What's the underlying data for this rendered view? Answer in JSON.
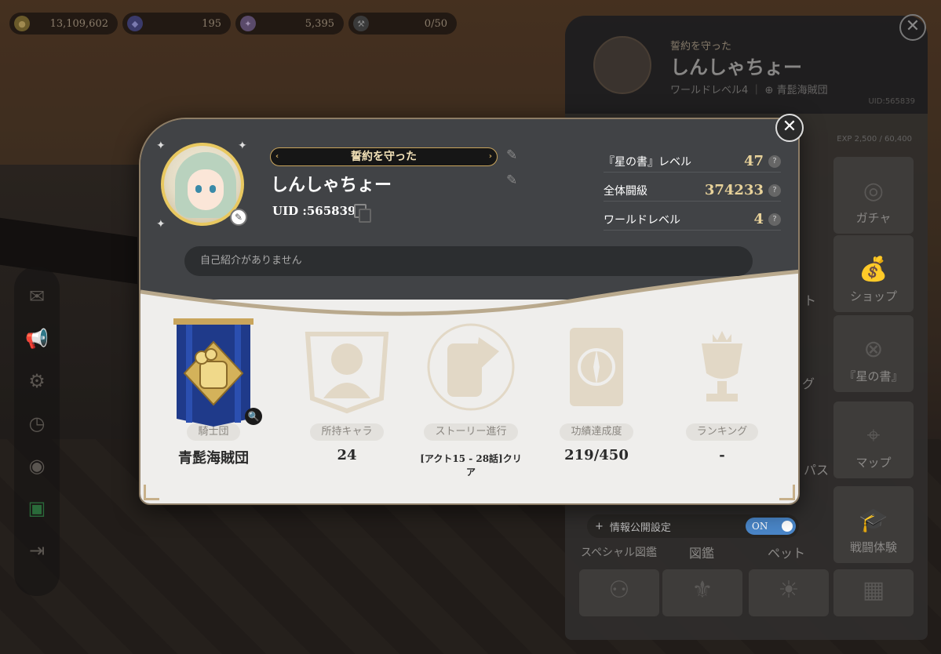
{
  "resources": [
    {
      "icon": "coin-icon",
      "value": "13,109,602"
    },
    {
      "icon": "gem-icon",
      "value": "195"
    },
    {
      "icon": "ticket-icon",
      "value": "5,395"
    },
    {
      "icon": "hammer-icon",
      "value": "0/50"
    }
  ],
  "side_panel": {
    "title": "誓約を守った",
    "name": "しんしゃちょー",
    "world_level": "ワールドレベル4",
    "guild": "青髭海賊団",
    "uid": "UID:565839",
    "exp": "EXP 2,500 / 60,400",
    "tiles": [
      {
        "label": "ガチャ"
      },
      {
        "label": "ショップ"
      },
      {
        "label": "『星の書』"
      },
      {
        "label": "マップ"
      },
      {
        "label": "スペシャル図鑑"
      },
      {
        "label": "図鑑"
      },
      {
        "label": "ペット"
      },
      {
        "label": "戦闘体験"
      }
    ],
    "partial_labels": {
      "a": "ト",
      "b": "グ",
      "c": "パス"
    }
  },
  "info_public": {
    "label": "情報公開設定",
    "toggle": "ON"
  },
  "profile": {
    "title": "誓約を守った",
    "name": "しんしゃちょー",
    "uid": "UID :565839",
    "intro_placeholder": "自己紹介がありません",
    "stats": [
      {
        "label": "『星の書』レベル",
        "value": "47"
      },
      {
        "label": "全体闘級",
        "value": "374233"
      },
      {
        "label": "ワールドレベル",
        "value": "4"
      }
    ],
    "badges": [
      {
        "label": "騎士団",
        "value": "青髭海賊団"
      },
      {
        "label": "所持キャラ",
        "value": "24"
      },
      {
        "label": "ストーリー進行",
        "value": "[アクト15 - 28話]クリア"
      },
      {
        "label": "功績達成度",
        "value": "219/450"
      },
      {
        "label": "ランキング",
        "value": "-"
      }
    ]
  },
  "colors": {
    "accent_gold": "#e8d29a",
    "title_border": "#c9a55c",
    "toggle_on": "#4a86c8",
    "banner_blue": "#1f3a8a"
  }
}
